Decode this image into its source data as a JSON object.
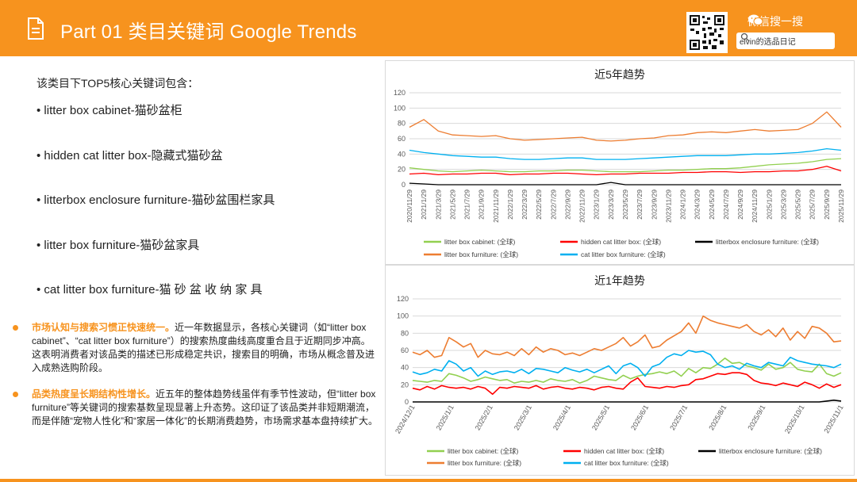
{
  "header": {
    "title": "Part 01 类目关键词 Google Trends",
    "wechat_label": "微信搜一搜",
    "search_text": "elvin的选品日记"
  },
  "intro": "该类目下TOP5核心关键词包含：",
  "keywords": [
    "• litter box cabinet-猫砂盆柜",
    "• hidden cat litter box-隐藏式猫砂盆",
    "• litterbox enclosure furniture-猫砂盆围栏家具",
    "• litter box furniture-猫砂盆家具",
    "• cat litter box furniture-猫 砂 盆 收 纳 家 具"
  ],
  "insights": [
    {
      "highlight": "市场认知与搜索习惯正快速统一。",
      "text": "近一年数据显示，各核心关键词（如“litter box cabinet”、“cat litter box furniture”）的搜索热度曲线高度重合且于近期同步冲高。这表明消费者对该品类的描述已形成稳定共识，搜索目的明确，市场从概念普及进入成熟选购阶段。"
    },
    {
      "highlight": "品类热度呈长期结构性增长。",
      "text": "近五年的整体趋势线虽伴有季节性波动，但“litter box furniture”等关键词的搜索基数呈现显著上升态势。这印证了该品类并非短期潮流，而是伴随“宠物人性化”和“家居一体化”的长期消费趋势，市场需求基本盘持续扩大。"
    }
  ],
  "colors": {
    "brand": "#f7931e",
    "cabinet": "#92d050",
    "hidden": "#ff0000",
    "enclosure": "#000000",
    "furniture": "#ed7d31",
    "cat_furniture": "#00b0f0"
  },
  "chart_data": [
    {
      "type": "line",
      "title": "近5年趋势",
      "ylim": [
        0,
        120
      ],
      "yticks": [
        0,
        20,
        40,
        60,
        80,
        100,
        120
      ],
      "x_labels": [
        "2020/11/29",
        "2021/1/29",
        "2021/3/29",
        "2021/5/29",
        "2021/7/29",
        "2021/9/29",
        "2021/11/29",
        "2022/1/29",
        "2022/3/29",
        "2022/5/29",
        "2022/7/29",
        "2022/9/29",
        "2022/11/29",
        "2023/1/29",
        "2023/3/29",
        "2023/5/29",
        "2023/7/29",
        "2023/9/29",
        "2023/11/29",
        "2024/1/29",
        "2024/3/29",
        "2024/5/29",
        "2024/7/29",
        "2024/9/29",
        "2024/11/29",
        "2025/1/29",
        "2025/3/29",
        "2025/5/29",
        "2025/7/29",
        "2025/9/29",
        "2025/11/29"
      ],
      "grid": true,
      "legend_position": "bottom",
      "series": [
        {
          "name": "litter box cabinet: (全球)",
          "color_key": "cabinet",
          "values": [
            22,
            20,
            18,
            17,
            18,
            19,
            18,
            17,
            17,
            18,
            18,
            19,
            19,
            18,
            17,
            17,
            17,
            18,
            19,
            19,
            20,
            21,
            21,
            22,
            24,
            26,
            27,
            28,
            30,
            33,
            34
          ]
        },
        {
          "name": "hidden cat litter box: (全球)",
          "color_key": "hidden",
          "values": [
            14,
            15,
            13,
            14,
            14,
            15,
            15,
            13,
            14,
            14,
            15,
            15,
            14,
            13,
            14,
            14,
            15,
            15,
            15,
            16,
            16,
            17,
            17,
            16,
            17,
            17,
            18,
            18,
            20,
            24,
            18
          ]
        },
        {
          "name": "litterbox enclosure furniture: (全球)",
          "color_key": "enclosure",
          "values": [
            2,
            1,
            0,
            0,
            0,
            0,
            0,
            0,
            0,
            0,
            0,
            0,
            0,
            0,
            3,
            0,
            0,
            0,
            0,
            0,
            0,
            0,
            0,
            0,
            0,
            0,
            0,
            0,
            0,
            0,
            0
          ]
        },
        {
          "name": "litter box furniture: (全球)",
          "color_key": "furniture",
          "values": [
            75,
            85,
            70,
            65,
            64,
            63,
            64,
            60,
            58,
            59,
            60,
            61,
            62,
            58,
            57,
            58,
            60,
            61,
            64,
            65,
            68,
            69,
            68,
            70,
            72,
            70,
            71,
            72,
            80,
            95,
            75
          ]
        },
        {
          "name": "cat litter box furniture: (全球)",
          "color_key": "cat_furniture",
          "values": [
            45,
            42,
            40,
            38,
            37,
            36,
            36,
            34,
            33,
            33,
            34,
            35,
            35,
            33,
            33,
            33,
            34,
            35,
            36,
            37,
            38,
            38,
            38,
            39,
            40,
            40,
            41,
            42,
            44,
            47,
            45
          ]
        }
      ]
    },
    {
      "type": "line",
      "title": "近1年趋势",
      "ylim": [
        0,
        120
      ],
      "yticks": [
        0,
        20,
        40,
        60,
        80,
        100,
        120
      ],
      "x_labels": [
        "2024/12/1",
        "2025/1/1",
        "2025/2/1",
        "2025/3/1",
        "2025/4/1",
        "2025/5/1",
        "2025/6/1",
        "2025/7/1",
        "2025/8/1",
        "2025/9/1",
        "2025/10/1",
        "2025/11/1"
      ],
      "grid": true,
      "legend_position": "bottom",
      "series": [
        {
          "name": "litter box cabinet: (全球)",
          "color_key": "cabinet",
          "values": [
            25,
            24,
            23,
            25,
            24,
            33,
            31,
            28,
            24,
            26,
            29,
            27,
            25,
            26,
            22,
            24,
            23,
            25,
            23,
            27,
            25,
            24,
            26,
            22,
            25,
            30,
            28,
            26,
            25,
            31,
            27,
            30,
            32,
            33,
            35,
            33,
            36,
            30,
            39,
            34,
            40,
            39,
            44,
            51,
            45,
            46,
            42,
            40,
            37,
            44,
            38,
            40,
            46,
            38,
            36,
            35,
            44,
            33,
            30,
            34
          ]
        },
        {
          "name": "hidden cat litter box: (全球)",
          "color_key": "hidden",
          "values": [
            16,
            14,
            18,
            15,
            19,
            17,
            16,
            17,
            15,
            18,
            16,
            9,
            17,
            16,
            18,
            17,
            16,
            19,
            15,
            17,
            18,
            16,
            15,
            17,
            16,
            14,
            17,
            18,
            16,
            15,
            23,
            28,
            18,
            17,
            16,
            18,
            17,
            19,
            20,
            26,
            27,
            30,
            33,
            32,
            34,
            34,
            32,
            25,
            22,
            21,
            19,
            22,
            20,
            18,
            23,
            20,
            16,
            21,
            17,
            20
          ]
        },
        {
          "name": "litterbox enclosure furniture: (全球)",
          "color_key": "enclosure",
          "values": [
            0,
            0,
            0,
            0,
            0,
            0,
            0,
            0,
            0,
            0,
            0,
            0,
            0,
            0,
            0,
            0,
            0,
            0,
            0,
            0,
            0,
            0,
            0,
            0,
            0,
            0,
            0,
            0,
            0,
            0,
            0,
            0,
            0,
            0,
            0,
            0,
            0,
            0,
            0,
            0,
            0,
            0,
            0,
            0,
            0,
            0,
            0,
            0,
            0,
            0,
            0,
            0,
            0,
            0,
            0,
            0,
            0,
            1,
            2,
            1
          ]
        },
        {
          "name": "litter box furniture: (全球)",
          "color_key": "furniture",
          "values": [
            58,
            55,
            60,
            52,
            54,
            75,
            70,
            64,
            68,
            52,
            60,
            56,
            55,
            58,
            54,
            62,
            55,
            64,
            58,
            62,
            60,
            55,
            57,
            54,
            58,
            62,
            60,
            64,
            68,
            75,
            65,
            70,
            78,
            63,
            65,
            72,
            77,
            82,
            92,
            80,
            100,
            95,
            92,
            90,
            88,
            86,
            90,
            82,
            78,
            84,
            76,
            86,
            72,
            82,
            74,
            88,
            86,
            80,
            70,
            71
          ]
        },
        {
          "name": "cat litter box furniture: (全球)",
          "color_key": "cat_furniture",
          "values": [
            35,
            32,
            34,
            38,
            36,
            48,
            44,
            36,
            40,
            30,
            36,
            32,
            35,
            36,
            34,
            38,
            33,
            39,
            38,
            36,
            34,
            40,
            37,
            35,
            38,
            34,
            38,
            42,
            33,
            42,
            45,
            40,
            30,
            41,
            44,
            52,
            56,
            54,
            60,
            58,
            59,
            55,
            44,
            40,
            42,
            38,
            45,
            42,
            40,
            46,
            44,
            42,
            52,
            48,
            46,
            44,
            43,
            42,
            40,
            44
          ]
        }
      ]
    }
  ]
}
